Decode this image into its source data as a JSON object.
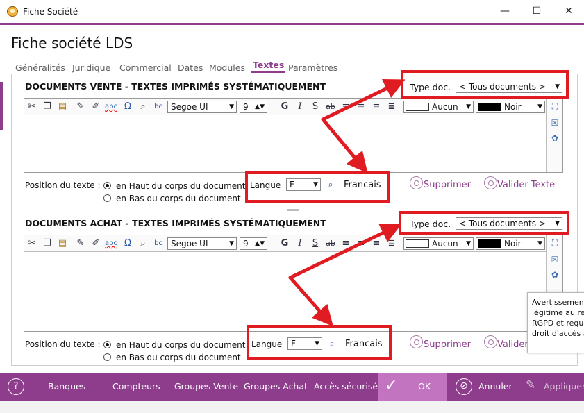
{
  "window": {
    "title": "Fiche Société",
    "min": "—",
    "max": "☐",
    "close": "✕"
  },
  "page_title": "Fiche société LDS",
  "tabs": [
    {
      "label": "Généralités"
    },
    {
      "label": "Juridique"
    },
    {
      "label": "Commercial"
    },
    {
      "label": "Dates"
    },
    {
      "label": "Modules"
    },
    {
      "label": "Textes"
    },
    {
      "label": "Paramètres"
    }
  ],
  "active_tab": "Textes",
  "sections": [
    {
      "title": "DOCUMENTS VENTE - TEXTES IMPRIMÉS SYSTÉMATIQUEMENT",
      "type_doc_label": "Type doc.",
      "type_doc_value": "< Tous documents >",
      "font": "Segoe UI",
      "size": "9",
      "bg_color": "Aucun",
      "fg_color": "Noir",
      "position_label": "Position du texte :",
      "radio_top": "en Haut du corps du document",
      "radio_bottom": "en Bas du corps du document",
      "langue_label": "Langue",
      "langue_value": "F",
      "langue_name": "Francais",
      "delete_label": "Supprimer",
      "validate_label": "Valider Texte"
    },
    {
      "title": "DOCUMENTS ACHAT - TEXTES IMPRIMÉS SYSTÉMATIQUEMENT",
      "type_doc_label": "Type doc.",
      "type_doc_value": "< Tous documents >",
      "font": "Segoe UI",
      "size": "9",
      "bg_color": "Aucun",
      "fg_color": "Noir",
      "position_label": "Position du texte :",
      "radio_top": "en Haut du corps du document",
      "radio_bottom": "en Bas du corps du document",
      "langue_label": "Langue",
      "langue_value": "F",
      "langue_name": "Francais",
      "delete_label": "Supprimer",
      "validate_label": "Valider"
    }
  ],
  "tooltip": {
    "lines": [
      "Avertissement",
      "légitime au reg",
      "RGPD et requi",
      "droit d'accès a"
    ]
  },
  "bottom": {
    "help": "?",
    "banques": "Banques",
    "compteurs": "Compteurs",
    "groupes_vente": "Groupes Vente",
    "groupes_achat": "Groupes Achat",
    "acces": "Accès sécurisé",
    "ok": "OK",
    "annuler": "Annuler",
    "appliquer": "Appliquer"
  },
  "colors": {
    "accent": "#8e3c8c",
    "annotation": "#e01b22",
    "ok_zone": "#c274c0"
  }
}
